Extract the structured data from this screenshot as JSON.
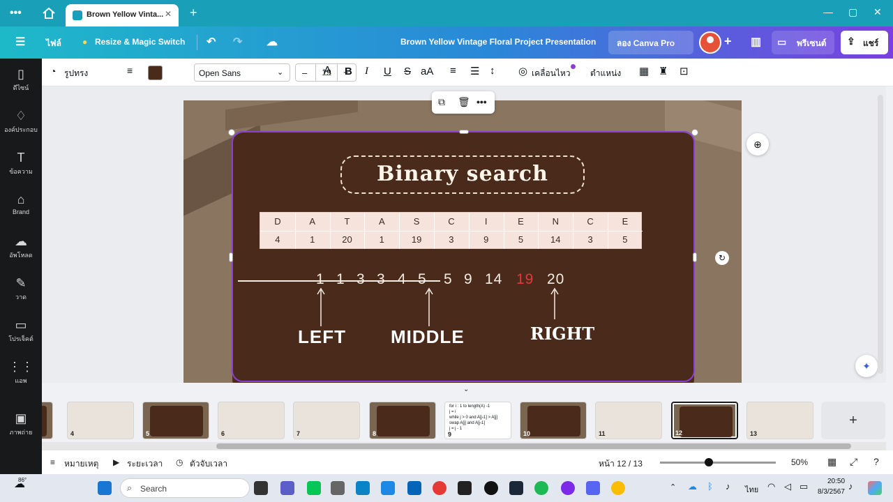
{
  "browser": {
    "tab_title": "Brown Yellow Vintage Floral Project Presentation",
    "tab_title_short": "Brown Yellow Vinta..."
  },
  "topbar": {
    "file": "ไฟล์",
    "resize": "Resize & Magic Switch",
    "doc_title": "Brown Yellow Vintage Floral Project Presentation",
    "try_pro": "ลอง Canva Pro",
    "present": "พรีเซนต์",
    "share": "แชร์"
  },
  "sidebar": [
    {
      "label": "ดีไซน์",
      "icon": "▯"
    },
    {
      "label": "องค์ประกอบ",
      "icon": "♢"
    },
    {
      "label": "ข้อความ",
      "icon": "T"
    },
    {
      "label": "Brand",
      "icon": "⌂"
    },
    {
      "label": "อัพโหลด",
      "icon": "☁"
    },
    {
      "label": "วาด",
      "icon": "✎"
    },
    {
      "label": "โปรเจ็คต์",
      "icon": "▭"
    },
    {
      "label": "แอพ",
      "icon": "⋮⋮"
    },
    {
      "label": "ภาพถ่าย",
      "icon": "▣"
    }
  ],
  "toolbar": {
    "shape": "รูปทรง",
    "font": "Open Sans",
    "font_size": "19",
    "animate": "เคลื่อนไหว",
    "position": "ตำแหน่ง",
    "text_color": "#4a2a18"
  },
  "slide": {
    "title": "Binary search",
    "table": {
      "letters": [
        "D",
        "A",
        "T",
        "A",
        "S",
        "C",
        "I",
        "E",
        "N",
        "C",
        "E"
      ],
      "values": [
        "4",
        "1",
        "20",
        "1",
        "19",
        "3",
        "9",
        "5",
        "14",
        "3",
        "5"
      ]
    },
    "sorted": [
      "1",
      "1",
      "3",
      "3",
      "4",
      "5",
      "5",
      "9",
      "14",
      "19",
      "20"
    ],
    "highlight_color": "#e23a3a",
    "labels": {
      "left": "LEFT",
      "middle": "MIDDLE",
      "right": "RIGHT"
    }
  },
  "filmstrip": {
    "pages": [
      "4",
      "5",
      "6",
      "7",
      "8",
      "9",
      "10",
      "11",
      "12",
      "13"
    ],
    "selected": "12",
    "code_lines": [
      "for i : 1 to length(A) -1",
      "j = i",
      "while j > 0 and A[j-1] > A[j]",
      "swap A[j] and A[j-1]",
      "j = j - 1"
    ]
  },
  "bottombar": {
    "notes": "หมายเหตุ",
    "duration": "ระยะเวลา",
    "timer": "ตัวจับเวลา",
    "page": "หน้า 12 / 13",
    "zoom": "50%",
    "zoom_level": 0.5
  },
  "taskbar": {
    "weather": "86°",
    "search": "Search",
    "lang": "ไทย",
    "time": "20:50",
    "date": "8/3/2567"
  }
}
